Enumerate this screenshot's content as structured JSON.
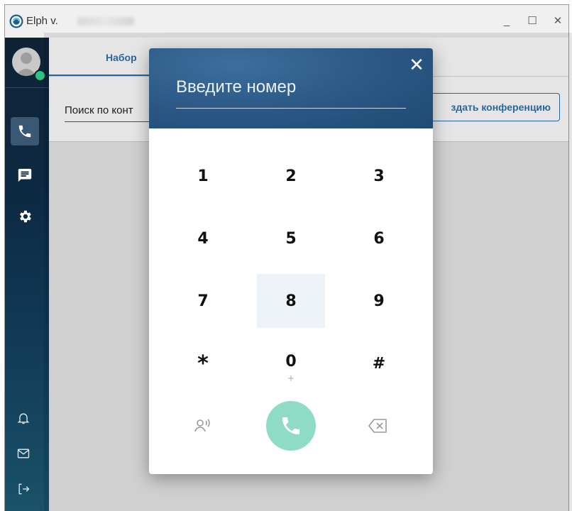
{
  "window": {
    "app_title": "Elph v.",
    "minimize": "_",
    "maximize": "☐",
    "close": "✕"
  },
  "tabs": {
    "dial_label": "Набор"
  },
  "search": {
    "text": "Поиск по конт"
  },
  "conference_button": {
    "label": "здать конференцию"
  },
  "dialog": {
    "close": "✕",
    "input_placeholder": "Введите номер",
    "keys": [
      {
        "digit": "1",
        "sub": ""
      },
      {
        "digit": "2",
        "sub": ""
      },
      {
        "digit": "3",
        "sub": ""
      },
      {
        "digit": "4",
        "sub": ""
      },
      {
        "digit": "5",
        "sub": ""
      },
      {
        "digit": "6",
        "sub": ""
      },
      {
        "digit": "7",
        "sub": ""
      },
      {
        "digit": "8",
        "sub": ""
      },
      {
        "digit": "9",
        "sub": ""
      },
      {
        "digit": "*",
        "sub": ""
      },
      {
        "digit": "0",
        "sub": "+"
      },
      {
        "digit": "#",
        "sub": ""
      }
    ]
  },
  "colors": {
    "accent": "#2d72b3",
    "sidebar": "#0f2236",
    "header": "#2a5784",
    "call_button": "#8fdcc6",
    "status_online": "#2ec27e"
  },
  "icons": {
    "sidebar": [
      "phone-icon",
      "chat-icon",
      "settings-icon"
    ],
    "sidebar_bottom": [
      "bell-icon",
      "mail-icon",
      "logout-icon"
    ],
    "dialog_actions": [
      "voicemail-icon",
      "phone-icon",
      "backspace-icon"
    ]
  }
}
